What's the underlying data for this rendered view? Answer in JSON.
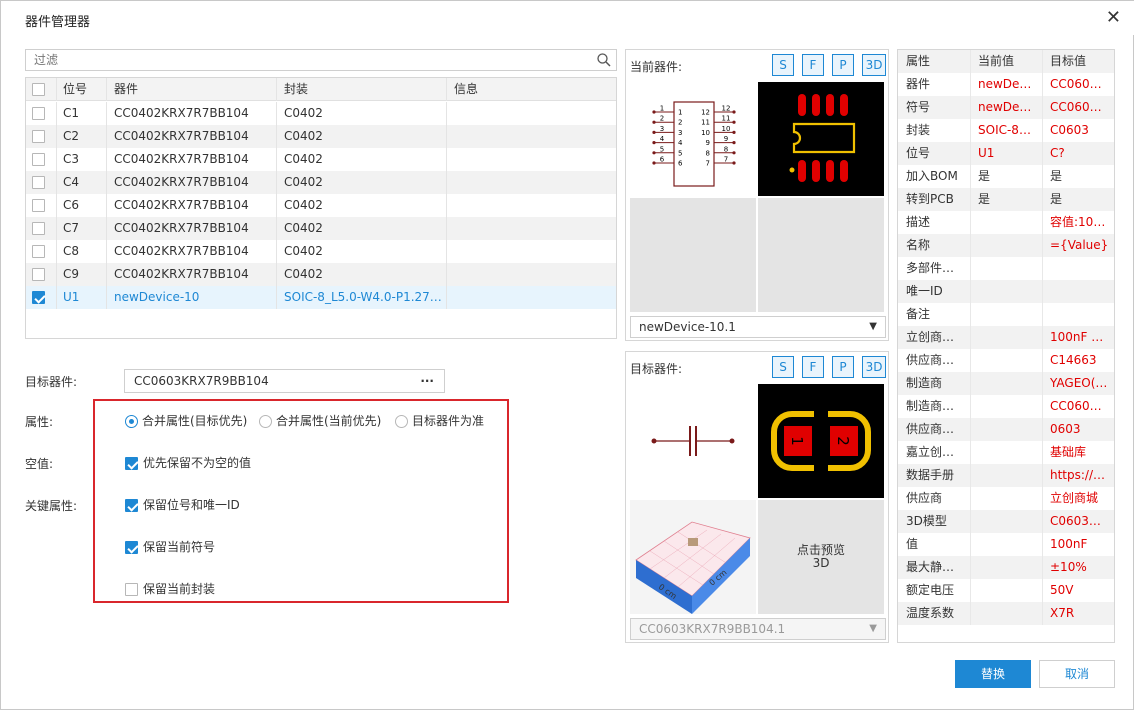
{
  "window": {
    "title": "器件管理器",
    "close_glyph": "✕"
  },
  "filter": {
    "placeholder": "过滤"
  },
  "table": {
    "headers": {
      "designator": "位号",
      "device": "器件",
      "footprint": "封装",
      "info": "信息"
    },
    "rows": [
      {
        "checked": false,
        "designator": "C1",
        "device": "CC0402KRX7R7BB104",
        "footprint": "C0402",
        "info": ""
      },
      {
        "checked": false,
        "designator": "C2",
        "device": "CC0402KRX7R7BB104",
        "footprint": "C0402",
        "info": ""
      },
      {
        "checked": false,
        "designator": "C3",
        "device": "CC0402KRX7R7BB104",
        "footprint": "C0402",
        "info": ""
      },
      {
        "checked": false,
        "designator": "C4",
        "device": "CC0402KRX7R7BB104",
        "footprint": "C0402",
        "info": ""
      },
      {
        "checked": false,
        "designator": "C6",
        "device": "CC0402KRX7R7BB104",
        "footprint": "C0402",
        "info": ""
      },
      {
        "checked": false,
        "designator": "C7",
        "device": "CC0402KRX7R7BB104",
        "footprint": "C0402",
        "info": ""
      },
      {
        "checked": false,
        "designator": "C8",
        "device": "CC0402KRX7R7BB104",
        "footprint": "C0402",
        "info": ""
      },
      {
        "checked": false,
        "designator": "C9",
        "device": "CC0402KRX7R7BB104",
        "footprint": "C0402",
        "info": ""
      },
      {
        "checked": true,
        "designator": "U1",
        "device": "newDevice-10",
        "footprint": "SOIC-8_L5.0-W4.0-P1.27…",
        "info": ""
      }
    ]
  },
  "form": {
    "target_label": "目标器件:",
    "target_value": "CC0603KRX7R9BB104",
    "target_more": "···",
    "attr_label": "属性:",
    "empty_label": "空值:",
    "key_label": "关键属性:",
    "radio_options": [
      "合并属性(目标优先)",
      "合并属性(当前优先)",
      "目标器件为准"
    ],
    "radio_selected": 0,
    "empty_option": "优先保留不为空的值",
    "key_options": [
      {
        "label": "保留位号和唯一ID",
        "checked": true
      },
      {
        "label": "保留当前符号",
        "checked": true
      },
      {
        "label": "保留当前封装",
        "checked": false
      }
    ]
  },
  "current_panel": {
    "label": "当前器件:",
    "buttons": [
      "S",
      "F",
      "P",
      "3D"
    ],
    "select_value": "newDevice-10.1",
    "pin_left": [
      "1",
      "2",
      "3",
      "4",
      "5",
      "6"
    ],
    "pin_right": [
      "12",
      "11",
      "10",
      "9",
      "8",
      "7"
    ]
  },
  "target_panel": {
    "label": "目标器件:",
    "buttons": [
      "S",
      "F",
      "P",
      "3D"
    ],
    "select_value": "CC0603KRX7R9BB104.1",
    "pad_labels": [
      "1",
      "2"
    ],
    "preview_3d_text": [
      "点击预览",
      "3D"
    ],
    "cm_labels": [
      "0 cm",
      "0 cm"
    ]
  },
  "properties": {
    "headers": [
      "属性",
      "当前值",
      "目标值"
    ],
    "rows": [
      {
        "name": "器件",
        "current": "newDe…",
        "target": "CC060…",
        "cur_red": true,
        "tgt_red": true
      },
      {
        "name": "符号",
        "current": "newDe…",
        "target": "CC060…",
        "cur_red": true,
        "tgt_red": true
      },
      {
        "name": "封装",
        "current": "SOIC-8…",
        "target": "C0603",
        "cur_red": true,
        "tgt_red": true
      },
      {
        "name": "位号",
        "current": "U1",
        "target": "C?",
        "cur_red": true,
        "tgt_red": true
      },
      {
        "name": "加入BOM",
        "current": "是",
        "target": "是",
        "cur_red": false,
        "tgt_red": false
      },
      {
        "name": "转到PCB",
        "current": "是",
        "target": "是",
        "cur_red": false,
        "tgt_red": false
      },
      {
        "name": "描述",
        "current": "",
        "target": "容值:10…",
        "cur_red": false,
        "tgt_red": true
      },
      {
        "name": "名称",
        "current": "",
        "target": "={Value}",
        "cur_red": false,
        "tgt_red": true
      },
      {
        "name": "多部件…",
        "current": "",
        "target": "",
        "cur_red": false,
        "tgt_red": false
      },
      {
        "name": "唯一ID",
        "current": "",
        "target": "",
        "cur_red": false,
        "tgt_red": false
      },
      {
        "name": "备注",
        "current": "",
        "target": "",
        "cur_red": false,
        "tgt_red": false
      },
      {
        "name": "立创商…",
        "current": "",
        "target": "100nF …",
        "cur_red": false,
        "tgt_red": true
      },
      {
        "name": "供应商…",
        "current": "",
        "target": "C14663",
        "cur_red": false,
        "tgt_red": true
      },
      {
        "name": "制造商",
        "current": "",
        "target": "YAGEO(…",
        "cur_red": false,
        "tgt_red": true
      },
      {
        "name": "制造商…",
        "current": "",
        "target": "CC060…",
        "cur_red": false,
        "tgt_red": true
      },
      {
        "name": "供应商…",
        "current": "",
        "target": "0603",
        "cur_red": false,
        "tgt_red": true
      },
      {
        "name": "嘉立创…",
        "current": "",
        "target": "基础库",
        "cur_red": false,
        "tgt_red": true
      },
      {
        "name": "数据手册",
        "current": "",
        "target": "https://a…",
        "cur_red": false,
        "tgt_red": true
      },
      {
        "name": "供应商",
        "current": "",
        "target": "立创商城",
        "cur_red": false,
        "tgt_red": true
      },
      {
        "name": "3D模型",
        "current": "",
        "target": "C0603…",
        "cur_red": false,
        "tgt_red": true
      },
      {
        "name": "值",
        "current": "",
        "target": "100nF",
        "cur_red": false,
        "tgt_red": true
      },
      {
        "name": "最大静…",
        "current": "",
        "target": "±10%",
        "cur_red": false,
        "tgt_red": true
      },
      {
        "name": "额定电压",
        "current": "",
        "target": "50V",
        "cur_red": false,
        "tgt_red": true
      },
      {
        "name": "温度系数",
        "current": "",
        "target": "X7R",
        "cur_red": false,
        "tgt_red": true
      }
    ]
  },
  "buttons": {
    "replace": "替换",
    "cancel": "取消"
  },
  "colors": {
    "accent": "#1e88d4",
    "diff_red": "#e00000",
    "highlight_box": "#d9262c",
    "pad_red": "#e00000",
    "pad_yellow": "#f0c000"
  }
}
